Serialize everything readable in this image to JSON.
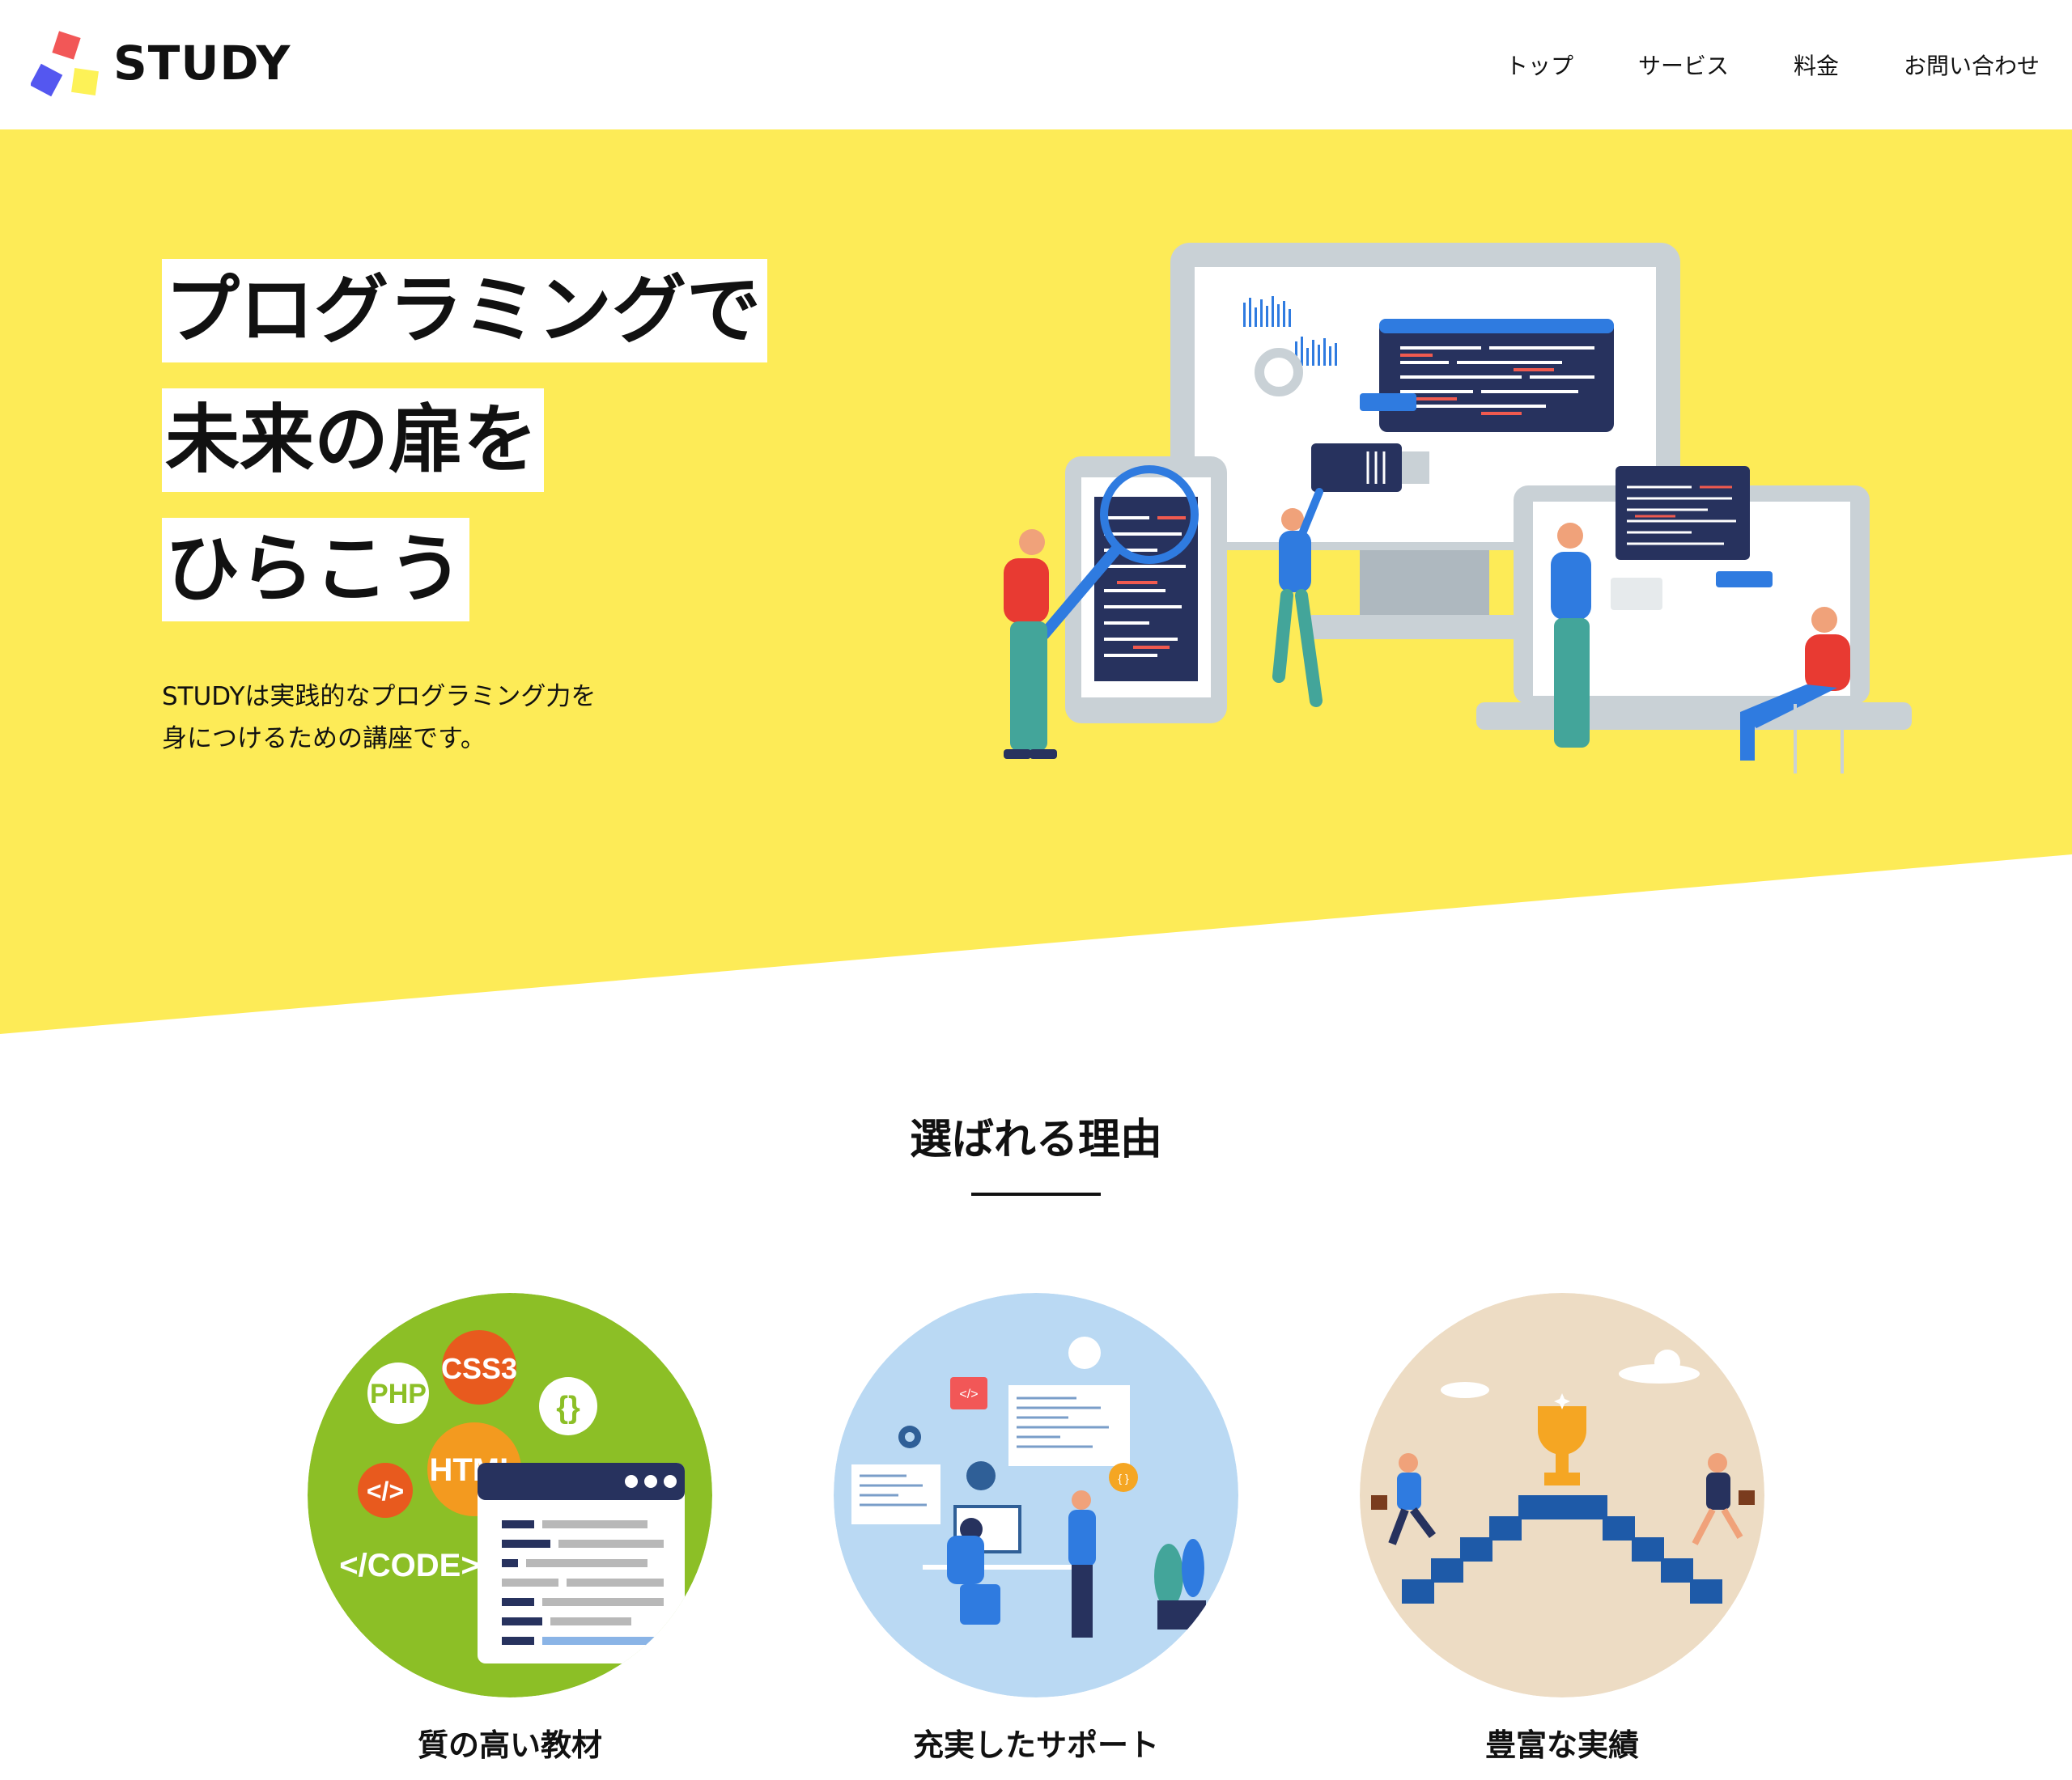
{
  "header": {
    "logo_text": "STUDY",
    "nav": [
      "トップ",
      "サービス",
      "料金",
      "お問い合わせ"
    ]
  },
  "hero": {
    "headline_lines": [
      "プログラミングで",
      "未来の扉を",
      "ひらこう"
    ],
    "description_lines": [
      "STUDYは実践的なプログラミング力を",
      "身につけるための講座です。"
    ],
    "background_color": "#fdeb57"
  },
  "reasons": {
    "title": "選ばれる理由",
    "items": [
      {
        "label": "質の高い教材",
        "circle_color": "#8cbf26",
        "badges": [
          "PHP",
          "CSS3",
          "{}",
          "HTML",
          "</>",
          "</CODE>"
        ]
      },
      {
        "label": "充実したサポート",
        "circle_color": "#bad9f3",
        "badges": [
          "</>",
          "{ }"
        ]
      },
      {
        "label": "豊富な実績",
        "circle_color": "#eddcc4"
      }
    ]
  },
  "colors": {
    "logo_red": "#f25757",
    "logo_blue": "#5457f0",
    "logo_yellow": "#fdf257",
    "accent_blue": "#1f6ed4",
    "dark_navy": "#27325e"
  }
}
